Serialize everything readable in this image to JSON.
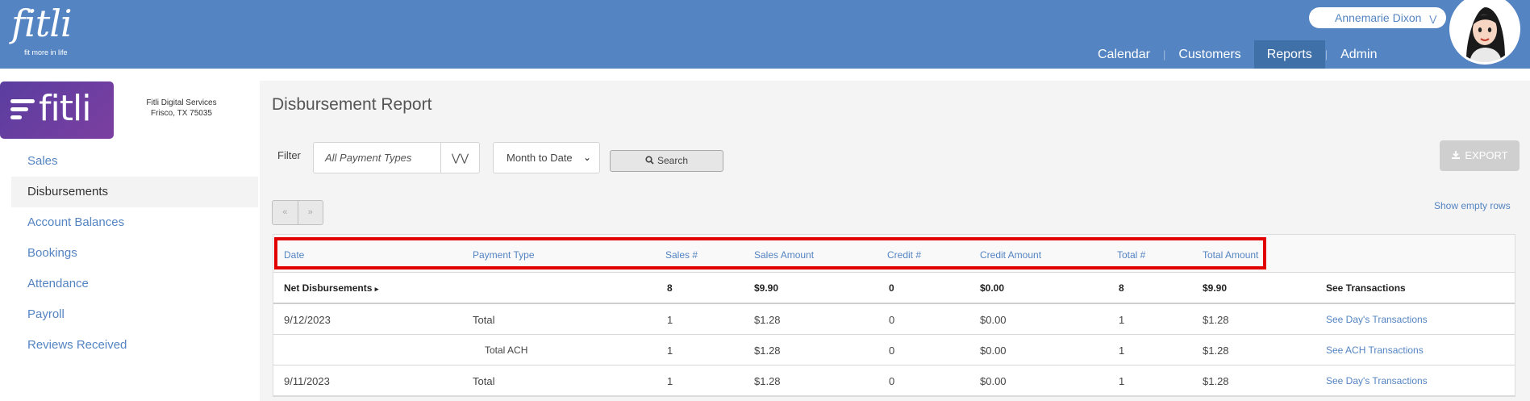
{
  "header": {
    "logo_word": "fitli",
    "logo_tagline": "fit more in life",
    "user_name": "Annemarie Dixon",
    "user_chevron": "chevron-down-icon",
    "nav": [
      {
        "label": "Calendar"
      },
      {
        "label": "Customers"
      },
      {
        "label": "Reports",
        "active": true
      },
      {
        "label": "Admin"
      }
    ],
    "nav_separator": "|"
  },
  "sidebar": {
    "brand_word": "fitli",
    "business_name": "Fitli Digital Services",
    "business_address": "Frisco, TX 75035",
    "items": [
      {
        "label": "Sales"
      },
      {
        "label": "Disbursements",
        "active": true
      },
      {
        "label": "Account Balances"
      },
      {
        "label": "Bookings"
      },
      {
        "label": "Attendance"
      },
      {
        "label": "Payroll"
      },
      {
        "label": "Reviews Received"
      }
    ]
  },
  "main": {
    "title": "Disbursement Report",
    "filter_label": "Filter",
    "payment_type_placeholder": "All Payment Types",
    "period_value": "Month to Date",
    "search_label": "Search",
    "export_label": "EXPORT",
    "pager_prev": "«",
    "pager_next": "»",
    "show_empty_rows": "Show empty rows",
    "columns": [
      "Date",
      "Payment Type",
      "Sales #",
      "Sales Amount",
      "Credit #",
      "Credit Amount",
      "Total #",
      "Total Amount"
    ],
    "net_row": {
      "label": "Net Disbursements",
      "sales_count": "8",
      "sales_amount": "$9.90",
      "credit_count": "0",
      "credit_amount": "$0.00",
      "total_count": "8",
      "total_amount": "$9.90",
      "link": "See Transactions"
    },
    "rows": [
      {
        "date": "9/12/2023",
        "payment_type": "Total",
        "sales_count": "1",
        "sales_amount": "$1.28",
        "credit_count": "0",
        "credit_amount": "$0.00",
        "total_count": "1",
        "total_amount": "$1.28",
        "link": "See Day's Transactions"
      },
      {
        "date": "",
        "payment_type": "Total ACH",
        "sales_count": "1",
        "sales_amount": "$1.28",
        "credit_count": "0",
        "credit_amount": "$0.00",
        "total_count": "1",
        "total_amount": "$1.28",
        "link": "See ACH Transactions"
      },
      {
        "date": "9/11/2023",
        "payment_type": "Total",
        "sales_count": "1",
        "sales_amount": "$1.28",
        "credit_count": "0",
        "credit_amount": "$0.00",
        "total_count": "1",
        "total_amount": "$1.28",
        "link": "See Day's Transactions"
      }
    ]
  },
  "colors": {
    "header_blue": "#5484c2",
    "active_nav": "#4070a8",
    "link_blue": "#5484c2",
    "highlight_red": "#e00000",
    "brand_purple": "#5a3ea0"
  }
}
